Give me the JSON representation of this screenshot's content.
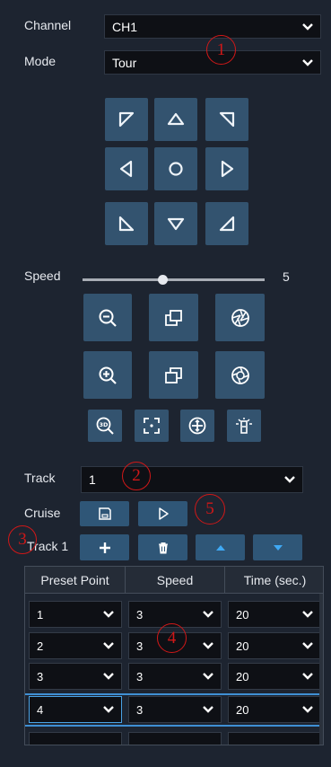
{
  "channel": {
    "label": "Channel",
    "value": "CH1"
  },
  "mode": {
    "label": "Mode",
    "value": "Tour"
  },
  "direction_pad": {
    "icons": [
      "arrow-up-left-icon",
      "arrow-up-icon",
      "arrow-up-right-icon",
      "arrow-left-icon",
      "center-icon",
      "arrow-right-icon",
      "arrow-down-left-icon",
      "arrow-down-icon",
      "arrow-down-right-icon"
    ]
  },
  "speed": {
    "label": "Speed",
    "value": "5",
    "level_fraction": 0.44
  },
  "lens": {
    "icons": [
      "zoom-out-icon",
      "focus-near-icon",
      "iris-close-icon",
      "zoom-in-icon",
      "focus-far-icon",
      "iris-open-icon"
    ]
  },
  "tools": {
    "icons": [
      "3d-zoom-icon",
      "focus-frame-icon",
      "ptz-reset-icon",
      "wiper-light-icon"
    ]
  },
  "track": {
    "label": "Track",
    "value": "1"
  },
  "cruise": {
    "label": "Cruise"
  },
  "track_row": {
    "label": "Track 1"
  },
  "table": {
    "headers": [
      "Preset Point",
      "Speed",
      "Time (sec.)"
    ],
    "rows": [
      {
        "preset": "1",
        "speed": "3",
        "time": "20"
      },
      {
        "preset": "2",
        "speed": "3",
        "time": "20"
      },
      {
        "preset": "3",
        "speed": "3",
        "time": "20"
      },
      {
        "preset": "4",
        "speed": "3",
        "time": "20"
      }
    ]
  },
  "markers": [
    "1",
    "2",
    "3",
    "4",
    "5"
  ],
  "colors": {
    "background": "#1d2430",
    "button": "#33536f",
    "accent": "#3fa9f5",
    "marker": "#d01818"
  }
}
